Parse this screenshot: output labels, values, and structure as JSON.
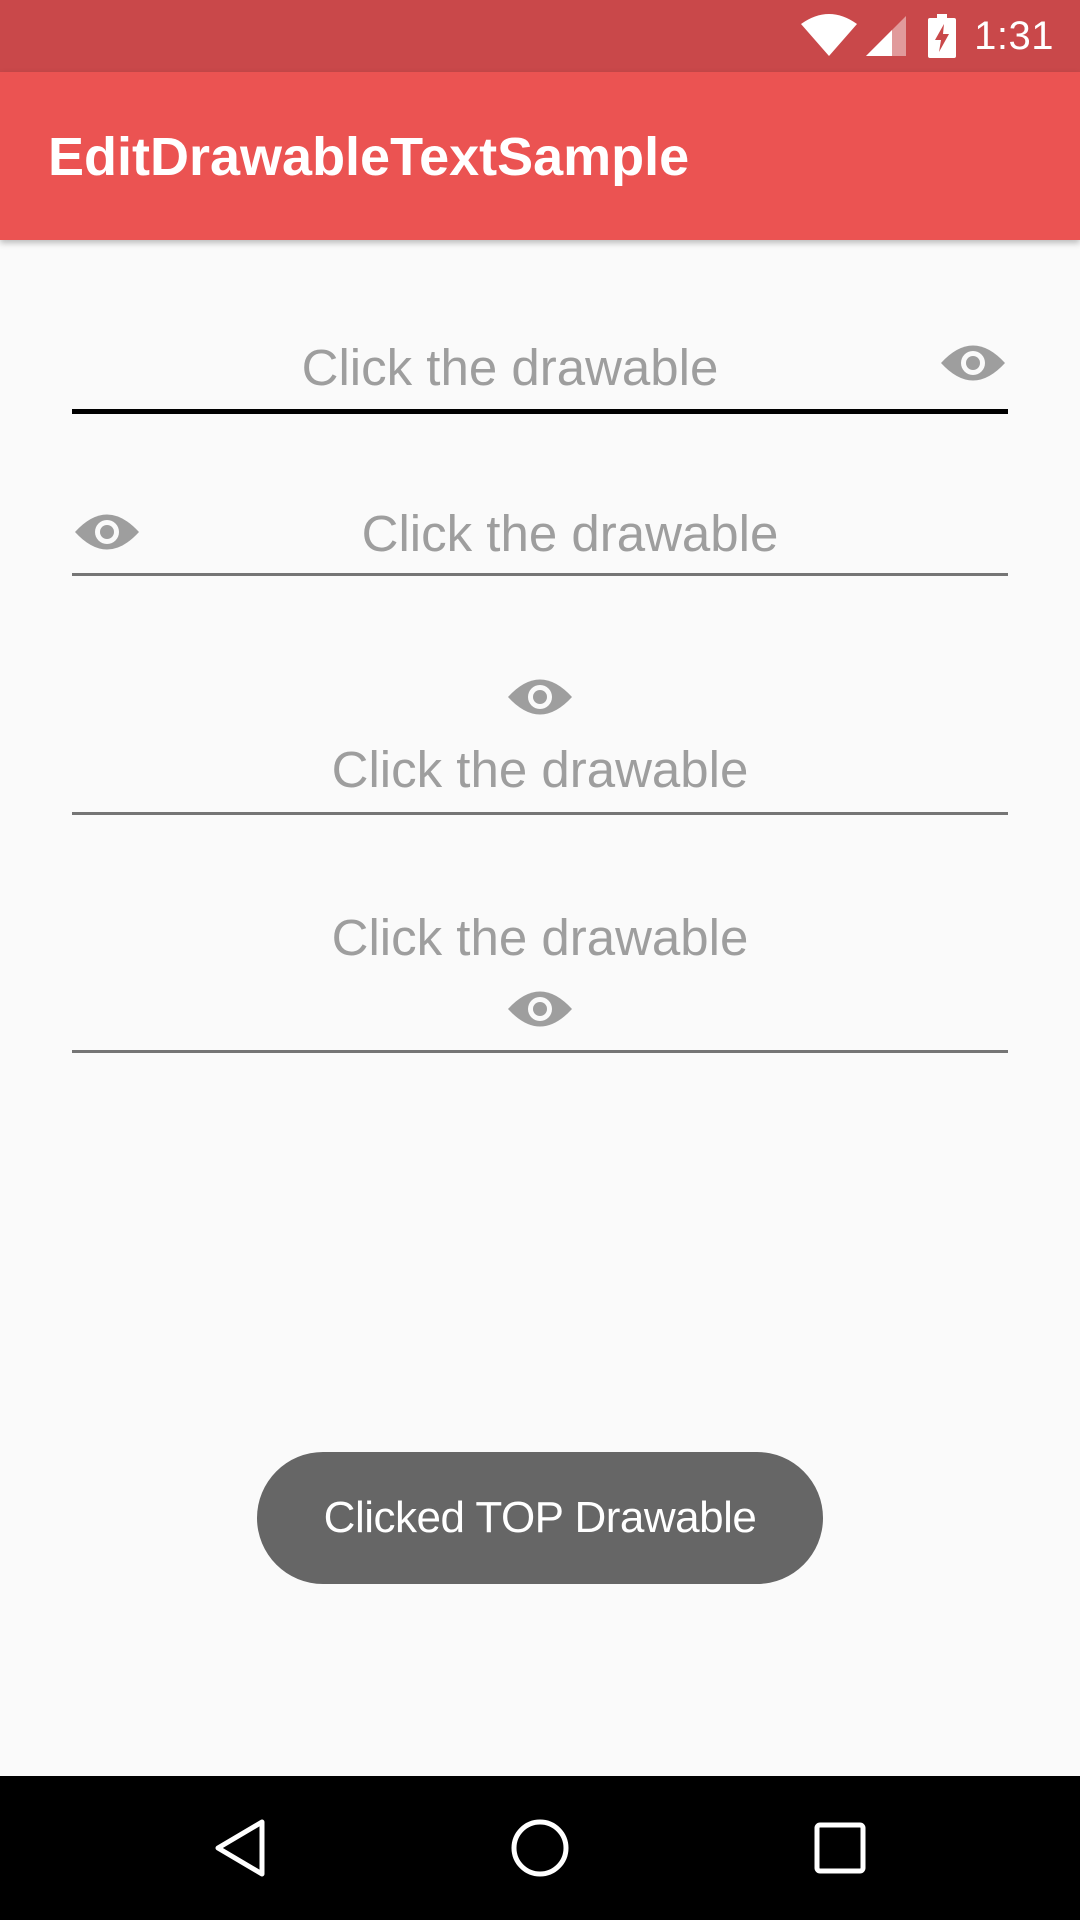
{
  "status_bar": {
    "time": "1:31",
    "icons": [
      "wifi-icon",
      "cell-signal-icon",
      "battery-charging-icon"
    ]
  },
  "app_bar": {
    "title": "EditDrawableTextSample"
  },
  "fields": [
    {
      "text": "Click the drawable",
      "drawable_position": "right",
      "focused": true,
      "icon": "eye-icon"
    },
    {
      "text": "Click the drawable",
      "drawable_position": "left",
      "focused": false,
      "icon": "eye-icon"
    },
    {
      "text": "Click the drawable",
      "drawable_position": "top",
      "focused": false,
      "icon": "eye-icon"
    },
    {
      "text": "Click the drawable",
      "drawable_position": "bottom",
      "focused": false,
      "icon": "eye-icon"
    }
  ],
  "toast": {
    "message": "Clicked TOP Drawable"
  },
  "nav_bar": {
    "buttons": [
      "back-icon",
      "home-icon",
      "recents-icon"
    ]
  },
  "colors": {
    "status_bar": "#c9484a",
    "app_bar": "#eb5352",
    "background": "#fafafa",
    "hint_text": "#9e9e9e",
    "icon": "#9e9e9e",
    "toast": "#666666",
    "nav_bar": "#000000"
  }
}
